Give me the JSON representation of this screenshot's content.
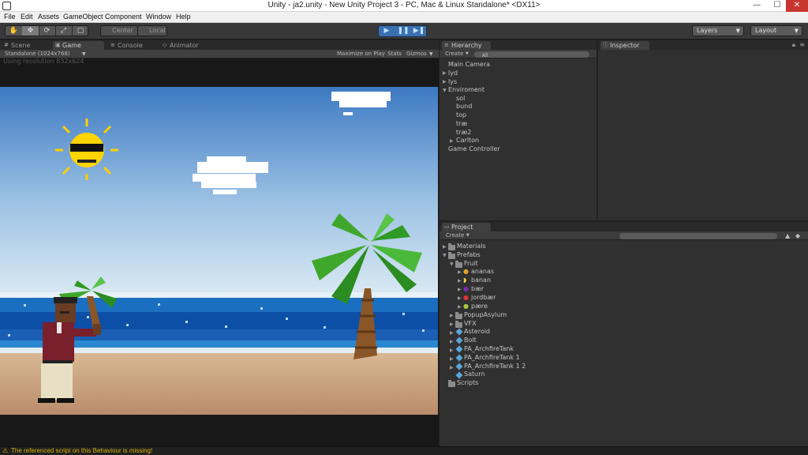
{
  "window": {
    "title": "Unity - ja2.unity - New Unity Project 3 - PC, Mac & Linux Standalone* <DX11>",
    "min": "—",
    "max": "☐",
    "close": "✕"
  },
  "menu": [
    "File",
    "Edit",
    "Assets",
    "GameObject",
    "Component",
    "Window",
    "Help"
  ],
  "toolbar": {
    "tools": [
      "✋",
      "✥",
      "⟳",
      "⤢",
      "▢"
    ],
    "pivot": "Center",
    "space": "Local",
    "play": "▶",
    "pause": "❚❚",
    "step": "▶❚",
    "layers": "Layers",
    "layout": "Layout"
  },
  "scene_tabs": {
    "scene": "Scene",
    "game": "Game",
    "console": "Console",
    "animator": "Animator"
  },
  "game_bar": {
    "aspect": "Standalone (1024x768)",
    "maximize": "Maximize on Play",
    "stats": "Stats",
    "gizmos": "Gizmos",
    "resolution_note": "Using resolution 832x624"
  },
  "hierarchy": {
    "tab": "Hierarchy",
    "create": "Create",
    "search": "All",
    "items": [
      {
        "label": "Main Camera"
      },
      {
        "label": "lyd"
      },
      {
        "label": "lys"
      },
      {
        "label": "Enviroment"
      },
      {
        "label": "sol"
      },
      {
        "label": "bund"
      },
      {
        "label": "top"
      },
      {
        "label": "træ"
      },
      {
        "label": "træ2"
      },
      {
        "label": "Carlton"
      },
      {
        "label": "Game Controller"
      }
    ]
  },
  "inspector": {
    "tab": "Inspector"
  },
  "project": {
    "tab": "Project",
    "create": "Create",
    "items": [
      {
        "label": "Materials"
      },
      {
        "label": "Prefabs"
      },
      {
        "label": "Fruit"
      },
      {
        "label": "ananas"
      },
      {
        "label": "banan"
      },
      {
        "label": "bær"
      },
      {
        "label": "jordbær"
      },
      {
        "label": "pære"
      },
      {
        "label": "PopupAsylum"
      },
      {
        "label": "VFX"
      },
      {
        "label": "Asteroid"
      },
      {
        "label": "Bolt"
      },
      {
        "label": "PA_ArchfireTank"
      },
      {
        "label": "PA_ArchfireTank 1"
      },
      {
        "label": "PA_ArchfireTank 1 2"
      },
      {
        "label": "Saturn"
      },
      {
        "label": "Scripts"
      }
    ]
  },
  "status": {
    "message": "The referenced script on this Behaviour is missing!"
  },
  "colors": {
    "sky_top": "#3d79c2",
    "sky_bottom": "#d8e8f3",
    "sea": "#1a5fb0",
    "sand": "#c79f7d",
    "accent_play": "#3a6fb0"
  }
}
